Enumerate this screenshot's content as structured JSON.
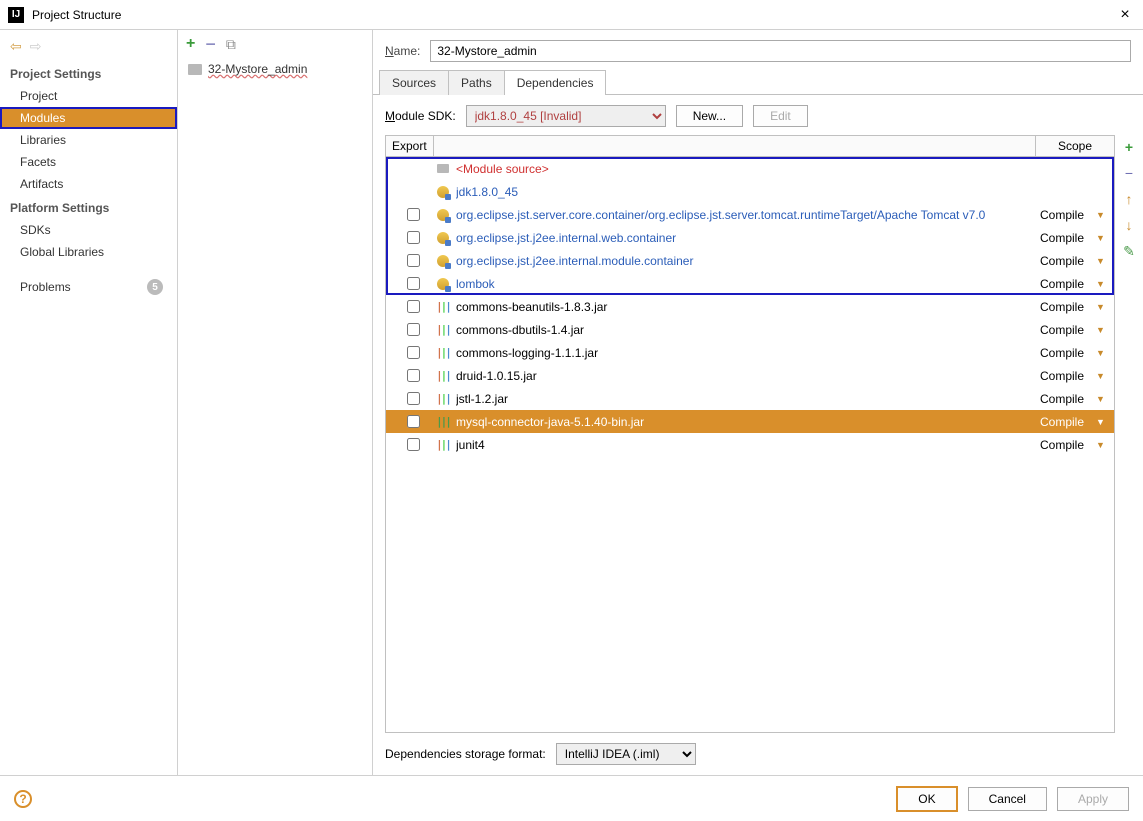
{
  "window": {
    "title": "Project Structure"
  },
  "sidebar": {
    "sections": {
      "project_settings": "Project Settings",
      "platform_settings": "Platform Settings"
    },
    "items": {
      "project": "Project",
      "modules": "Modules",
      "libraries": "Libraries",
      "facets": "Facets",
      "artifacts": "Artifacts",
      "sdks": "SDKs",
      "global_libraries": "Global Libraries",
      "problems": "Problems"
    },
    "problems_count": "5"
  },
  "modules": {
    "selected": "32-Mystore_admin"
  },
  "content": {
    "name_label": "Name:",
    "name_value": "32-Mystore_admin",
    "tabs": {
      "sources": "Sources",
      "paths": "Paths",
      "dependencies": "Dependencies"
    },
    "sdk_label": "Module SDK:",
    "sdk_value": "jdk1.8.0_45 [Invalid]",
    "new_btn": "New...",
    "edit_btn": "Edit",
    "header_export": "Export",
    "header_scope": "Scope",
    "deps": [
      {
        "cb": false,
        "icon": "folder",
        "name": "<Module source>",
        "cls": "red",
        "scope": ""
      },
      {
        "cb": false,
        "icon": "globe",
        "name": "jdk1.8.0_45",
        "cls": "blue",
        "scope": ""
      },
      {
        "cb": true,
        "icon": "globe",
        "name": "org.eclipse.jst.server.core.container/org.eclipse.jst.server.tomcat.runtimeTarget/Apache Tomcat v7.0",
        "cls": "blue",
        "scope": "Compile"
      },
      {
        "cb": true,
        "icon": "globe",
        "name": "org.eclipse.jst.j2ee.internal.web.container",
        "cls": "blue",
        "scope": "Compile"
      },
      {
        "cb": true,
        "icon": "globe",
        "name": "org.eclipse.jst.j2ee.internal.module.container",
        "cls": "blue",
        "scope": "Compile"
      },
      {
        "cb": true,
        "icon": "globe",
        "name": "lombok",
        "cls": "blue",
        "scope": "Compile"
      },
      {
        "cb": true,
        "icon": "lib-multi",
        "name": "commons-beanutils-1.8.3.jar",
        "cls": "",
        "scope": "Compile"
      },
      {
        "cb": true,
        "icon": "lib-multi",
        "name": "commons-dbutils-1.4.jar",
        "cls": "",
        "scope": "Compile"
      },
      {
        "cb": true,
        "icon": "lib-multi",
        "name": "commons-logging-1.1.1.jar",
        "cls": "",
        "scope": "Compile"
      },
      {
        "cb": true,
        "icon": "lib-multi",
        "name": "druid-1.0.15.jar",
        "cls": "",
        "scope": "Compile"
      },
      {
        "cb": true,
        "icon": "lib-multi",
        "name": "jstl-1.2.jar",
        "cls": "",
        "scope": "Compile"
      },
      {
        "cb": true,
        "icon": "lib-green",
        "name": "mysql-connector-java-5.1.40-bin.jar",
        "cls": "",
        "scope": "Compile",
        "selected": true
      },
      {
        "cb": true,
        "icon": "lib-multi",
        "name": "junit4",
        "cls": "",
        "scope": "Compile"
      }
    ],
    "highlight_rows": 6,
    "storage_label": "Dependencies storage format:",
    "storage_value": "IntelliJ IDEA (.iml)"
  },
  "footer": {
    "ok": "OK",
    "cancel": "Cancel",
    "apply": "Apply"
  }
}
